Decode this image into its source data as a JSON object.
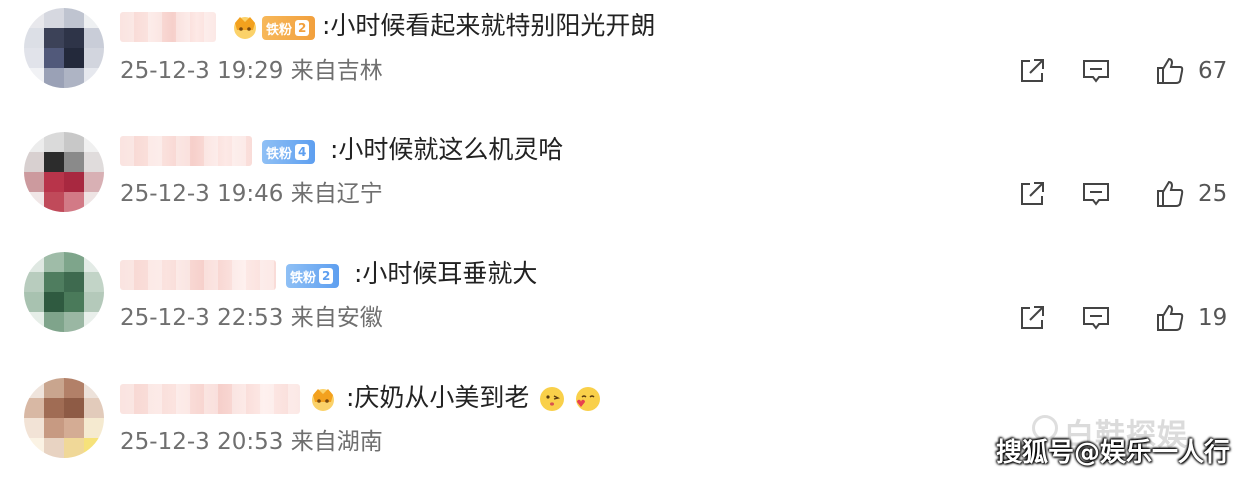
{
  "comments": [
    {
      "badge_label": "铁粉",
      "badge_level": "2",
      "badge_style": "orange",
      "has_crown": true,
      "text": ":小时候看起来就特别阳光开朗",
      "date": "25-12-3",
      "time": "19:29",
      "location": "来自吉林",
      "likes": "67",
      "avatar_colors": [
        "#e8e8ec",
        "#d6d8e0",
        "#bfc4d0",
        "#eef0f2",
        "#dcdfe6",
        "#3c4258",
        "#2e3448",
        "#c9cdd8",
        "#e1e3ea",
        "#51597a",
        "#23293b",
        "#d2d5de",
        "#f1f2f5",
        "#9aa1b6",
        "#aeb4c4",
        "#e6e8ee"
      ]
    },
    {
      "badge_label": "铁粉",
      "badge_level": "4",
      "badge_style": "blue",
      "has_crown": false,
      "text": ":小时候就这么机灵哈",
      "date": "25-12-3",
      "time": "19:46",
      "location": "来自辽宁",
      "likes": "25",
      "avatar_colors": [
        "#ececec",
        "#dadada",
        "#c8c8c8",
        "#f0f0f0",
        "#d8d0d0",
        "#2c2c2c",
        "#8a8a8a",
        "#e0dcdc",
        "#cc9a9e",
        "#b8344a",
        "#a82840",
        "#d8b0b4",
        "#f0e6e6",
        "#c04a5a",
        "#d27a86",
        "#eee4e4"
      ]
    },
    {
      "badge_label": "铁粉",
      "badge_level": "2",
      "badge_style": "blue",
      "has_crown": false,
      "text": ":小时候耳垂就大",
      "date": "25-12-3",
      "time": "22:53",
      "location": "来自安徽",
      "likes": "19",
      "avatar_colors": [
        "#dfe8e2",
        "#9fbca8",
        "#7ea58b",
        "#e3ebe6",
        "#b8ccbe",
        "#4f7d5f",
        "#3e6a4f",
        "#c2d4c7",
        "#a8c2b0",
        "#2f5a40",
        "#4a7a5a",
        "#b4c9ba",
        "#e6eee8",
        "#7fa48b",
        "#9ab7a3",
        "#e9efeb"
      ]
    },
    {
      "badge_label": "",
      "badge_level": "",
      "badge_style": "none",
      "has_crown": true,
      "text": ":庆奶从小美到老",
      "date": "25-12-3",
      "time": "20:53",
      "location": "来自湖南",
      "likes": "",
      "avatar_colors": [
        "#efe4dc",
        "#c9a58e",
        "#b28068",
        "#ede2da",
        "#d8b8a4",
        "#a06c54",
        "#8e5b45",
        "#e2cbbb",
        "#f2e3d6",
        "#c79a82",
        "#d4ac94",
        "#f5ead0",
        "#fbf3e4",
        "#e8d3c2",
        "#f0d898",
        "#f6e27a"
      ]
    }
  ],
  "watermark_text": "搜狐号@娱乐一人行",
  "watermark_bg_text": "白鞋探娱",
  "colors": {
    "meta_gray": "#6f6f6f",
    "icon_gray": "#444444",
    "badge_orange": "#f2a03d",
    "badge_blue": "#5e9ff0"
  }
}
